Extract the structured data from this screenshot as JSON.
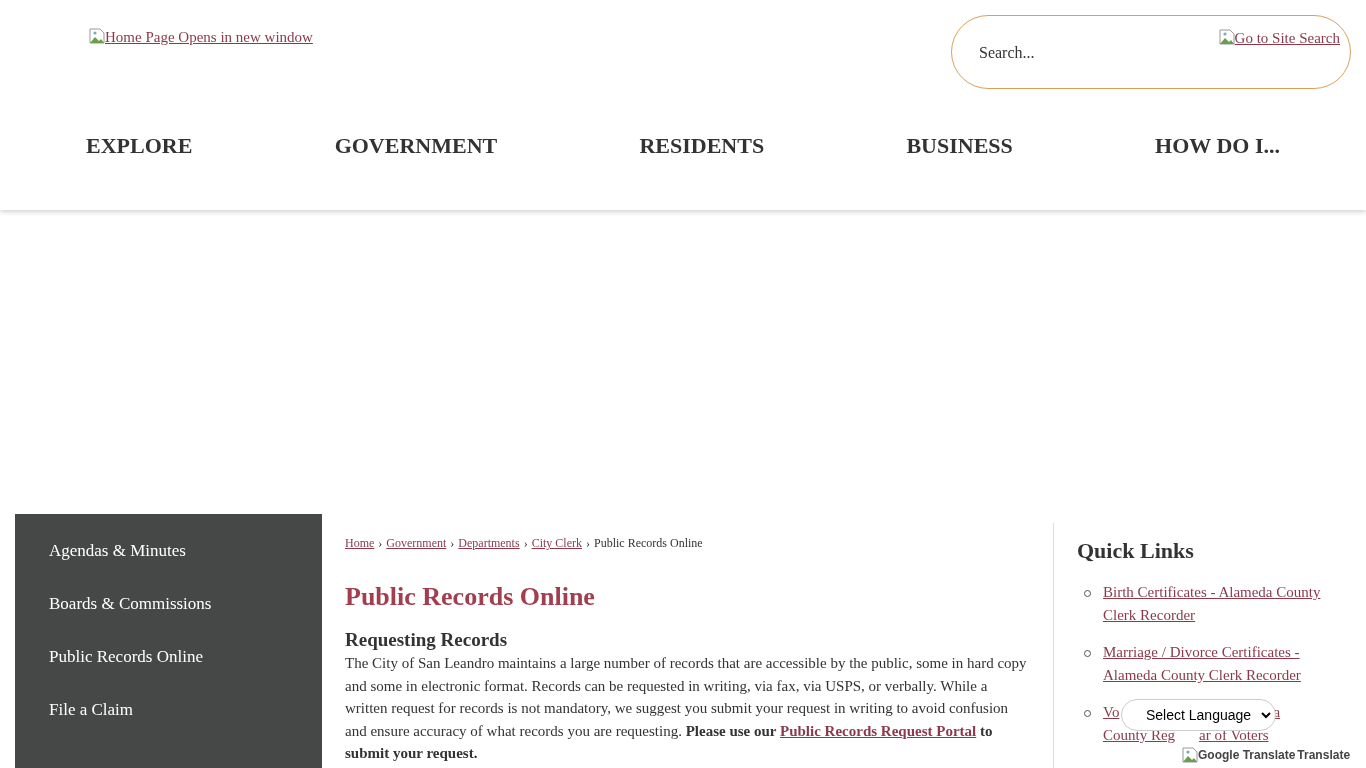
{
  "header": {
    "logo_link": "Home Page Opens in new window",
    "search": {
      "placeholder": "Search...",
      "button_link": "Go to Site Search"
    },
    "nav": [
      "EXPLORE",
      "GOVERNMENT",
      "RESIDENTS",
      "BUSINESS",
      "HOW DO I..."
    ]
  },
  "sidebar": {
    "items": [
      {
        "label": "Agendas & Minutes",
        "selected": false
      },
      {
        "label": "Boards & Commissions",
        "selected": false
      },
      {
        "label": "Public Records Online",
        "selected": false
      },
      {
        "label": "File a Claim",
        "selected": false
      }
    ]
  },
  "breadcrumb": {
    "separator": "›",
    "links": [
      "Home",
      "Government",
      "Departments",
      "City Clerk"
    ],
    "current": "Public Records Online"
  },
  "title": "Public Records Online",
  "section": {
    "heading": "Requesting Records",
    "text": "The City of San Leandro maintains a large number of records that are accessible by the public, some in hard copy and some in electronic format. Records can be requested in writing, via fax, via USPS, or verbally. While a written request for records is not mandatory, we suggest you submit your request in writing to avoid confusion and ensure accuracy of what records you are requesting. ",
    "bold_before": "Please use our ",
    "link": "Public Records Request Portal",
    "bold_after": " to submit your request."
  },
  "quick_links": {
    "heading": "Quick Links",
    "items": [
      {
        "kind": "full",
        "text": "Birth Certificates - Alameda County Clerk Recorder"
      },
      {
        "kind": "full",
        "text": "Marriage / Divorce Certificates - Alameda County Clerk Recorder"
      },
      {
        "kind": "covered",
        "parts": [
          "Vo",
          "a",
          "County Reg",
          "ar of Voters"
        ]
      }
    ]
  },
  "translate": {
    "select": "Select Language",
    "logo_alt": "Google Translate",
    "label": "Translate"
  }
}
